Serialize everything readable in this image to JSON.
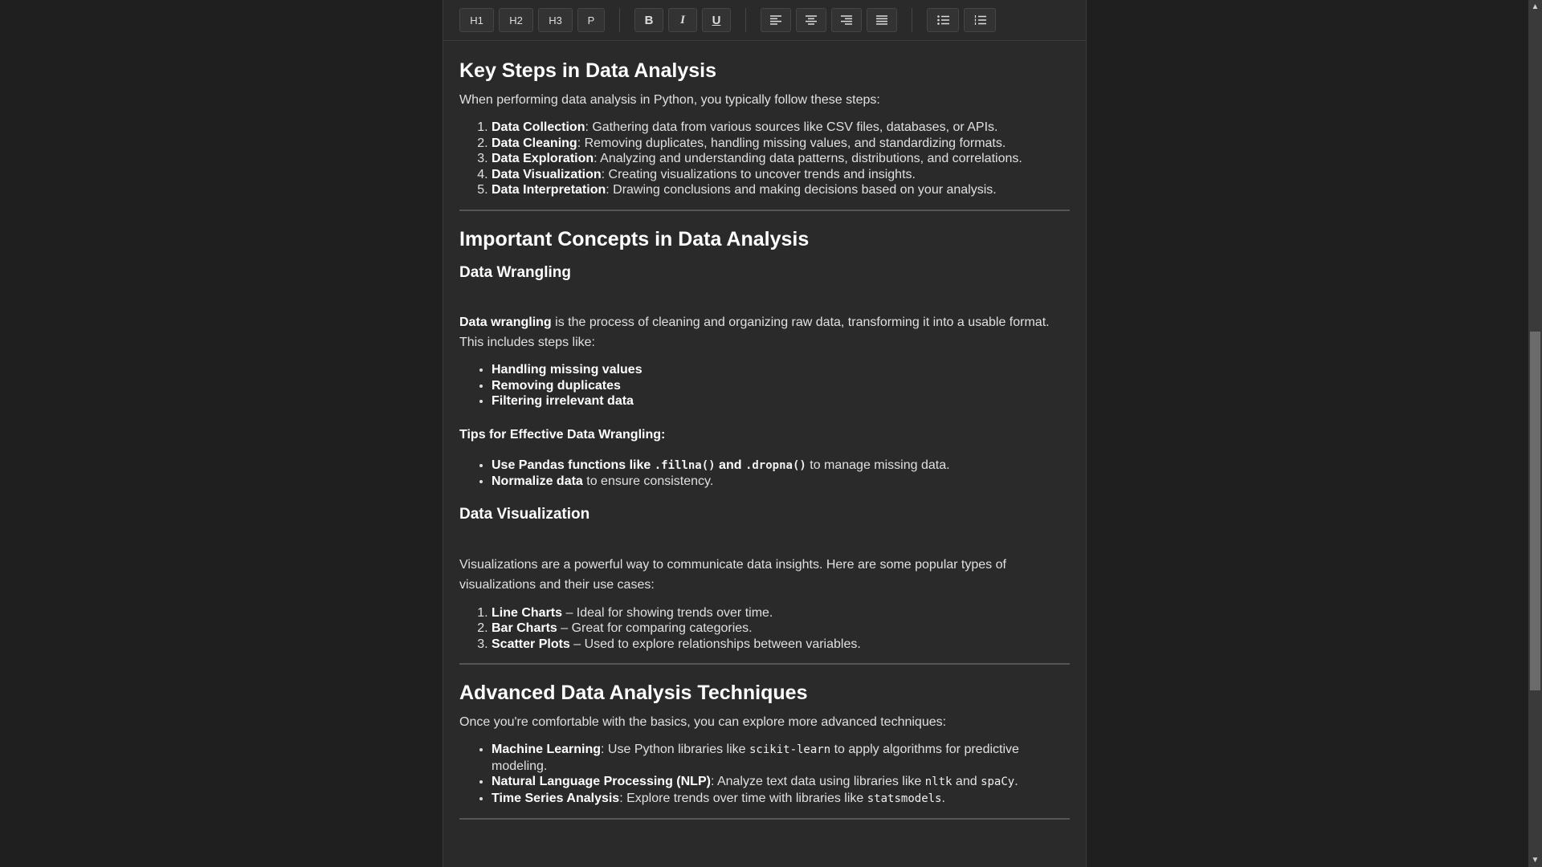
{
  "toolbar": {
    "h1": "H1",
    "h2": "H2",
    "h3": "H3",
    "p": "P",
    "bold": "B",
    "italic": "I",
    "underline": "U"
  },
  "sections": {
    "steps": {
      "title": "Key Steps in Data Analysis",
      "intro": "When performing data analysis in Python, you typically follow these steps:",
      "items": [
        {
          "term": "Data Collection",
          "text": ": Gathering data from various sources like CSV files, databases, or APIs."
        },
        {
          "term": "Data Cleaning",
          "text": ": Removing duplicates, handling missing values, and standardizing formats."
        },
        {
          "term": "Data Exploration",
          "text": ": Analyzing and understanding data patterns, distributions, and correlations."
        },
        {
          "term": "Data Visualization",
          "text": ": Creating visualizations to uncover trends and insights."
        },
        {
          "term": "Data Interpretation",
          "text": ": Drawing conclusions and making decisions based on your analysis."
        }
      ]
    },
    "concepts": {
      "title": "Important Concepts in Data Analysis",
      "wrangling": {
        "title": "Data Wrangling",
        "intro_term": "Data wrangling",
        "intro_text": " is the process of cleaning and organizing raw data, transforming it into a usable format. This includes steps like:",
        "items": [
          "Handling missing values",
          "Removing duplicates",
          "Filtering irrelevant data"
        ],
        "tips_title": "Tips for Effective Data Wrangling:",
        "tip1_a": "Use Pandas functions like ",
        "tip1_code1": ".fillna()",
        "tip1_and": " and ",
        "tip1_code2": ".dropna()",
        "tip1_text": " to manage missing data.",
        "tip2_term": "Normalize data",
        "tip2_text": " to ensure consistency."
      },
      "visualization": {
        "title": "Data Visualization",
        "intro": "Visualizations are a powerful way to communicate data insights. Here are some popular types of visualizations and their use cases:",
        "items": [
          {
            "term": "Line Charts",
            "text": " – Ideal for showing trends over time."
          },
          {
            "term": "Bar Charts",
            "text": " – Great for comparing categories."
          },
          {
            "term": "Scatter Plots",
            "text": " – Used to explore relationships between variables."
          }
        ]
      }
    },
    "advanced": {
      "title": "Advanced Data Analysis Techniques",
      "intro": "Once you're comfortable with the basics, you can explore more advanced techniques:",
      "ml_term": "Machine Learning",
      "ml_text1": ": Use Python libraries like ",
      "ml_code": "scikit-learn",
      "ml_text2": " to apply algorithms for predictive modeling.",
      "nlp_term": "Natural Language Processing (NLP)",
      "nlp_text1": ": Analyze text data using libraries like ",
      "nlp_code1": "nltk",
      "nlp_and": " and ",
      "nlp_code2": "spaCy",
      "nlp_end": ".",
      "ts_term": "Time Series Analysis",
      "ts_text": ": Explore trends over time with libraries like ",
      "ts_code": "statsmodels",
      "ts_end": "."
    }
  }
}
